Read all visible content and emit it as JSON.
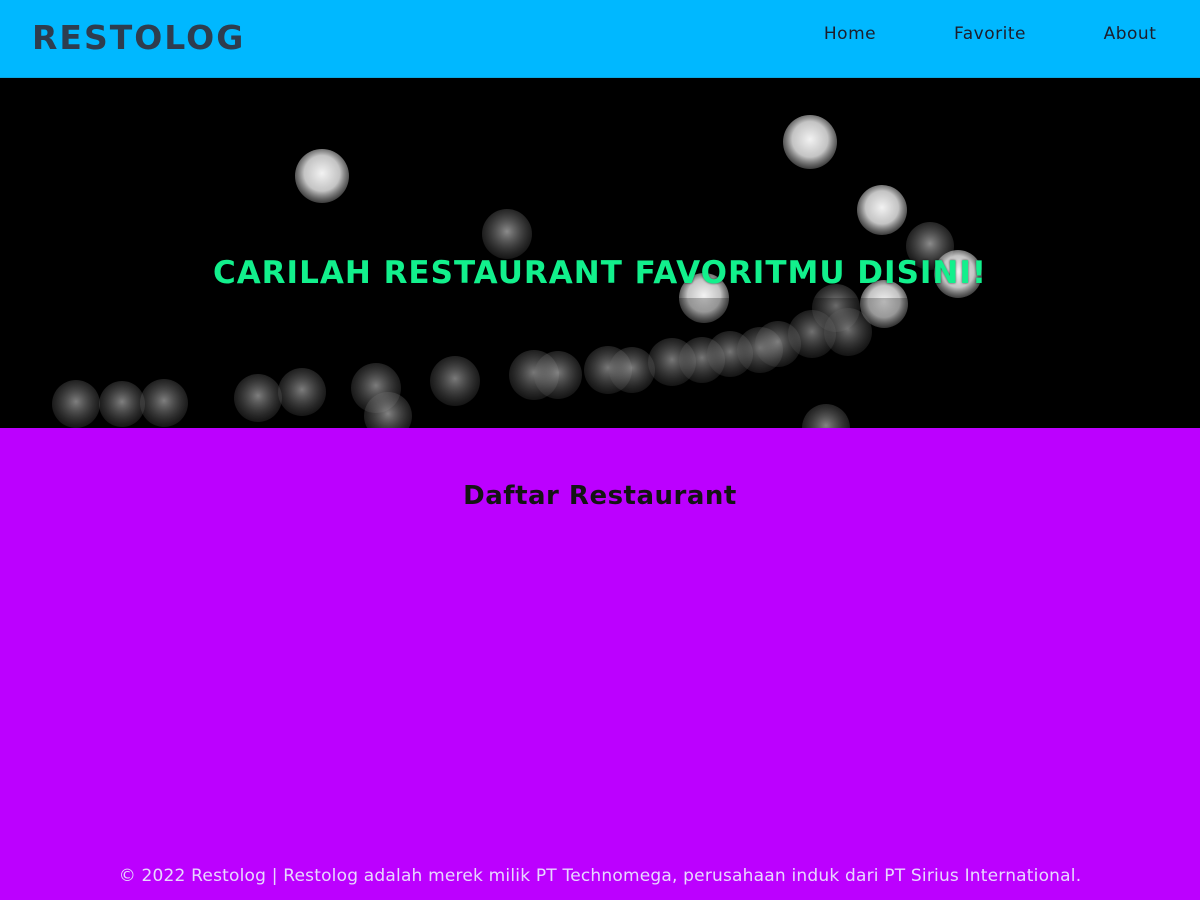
{
  "header": {
    "brand": "RESTOLOG",
    "nav": [
      {
        "label": "Home"
      },
      {
        "label": "Favorite"
      },
      {
        "label": "About"
      }
    ]
  },
  "hero": {
    "title": "CARILAH RESTAURANT FAVORITMU DISINI!"
  },
  "main": {
    "section_title": "Daftar Restaurant"
  },
  "footer": {
    "text": "© 2022 Restolog | Restolog adalah merek milik PT Technomega, perusahaan induk dari PT Sirius International."
  },
  "theme": {
    "topbar": "#00b8ff",
    "content_bg": "#bc00ff",
    "hero_text": "#12f08c",
    "brand_text": "#2e3d4f"
  }
}
